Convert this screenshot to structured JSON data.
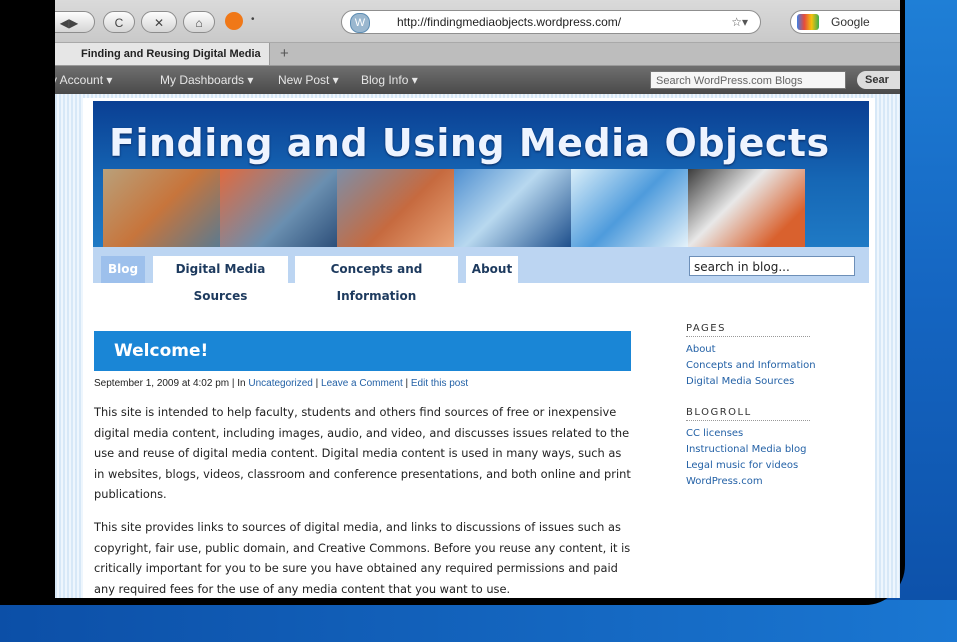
{
  "browser": {
    "url": "http://findingmediaobjects.wordpress.com/",
    "search_engine": "Google",
    "tab_title": "Finding and Reusing Digital Media",
    "new_tab": "+",
    "back_glyph": "◀▶",
    "reload_glyph": "C",
    "stop_glyph": "✕",
    "home_glyph": "⌂",
    "bookmark_glyph": "☆▾"
  },
  "wp_admin_bar": {
    "items": [
      "My Account ▾",
      "My Dashboards ▾",
      "New Post ▾",
      "Blog Info ▾"
    ],
    "search_placeholder": "Search WordPress.com Blogs",
    "search_button": "Sear"
  },
  "site": {
    "title": "Finding and Using Media Objects",
    "nav": [
      {
        "label": "Blog",
        "active": true
      },
      {
        "label": "Digital Media Sources",
        "active": false
      },
      {
        "label": "Concepts and Information",
        "active": false
      },
      {
        "label": "About",
        "active": false
      }
    ],
    "search_value": "search in blog..."
  },
  "post": {
    "title": "Welcome!",
    "meta_prefix": "September 1, 2009 at 4:02 pm | In ",
    "category": "Uncategorized",
    "sep1": " | ",
    "comment_link": "Leave a Comment",
    "sep2": " | ",
    "edit_link": "Edit this post",
    "paragraph1": "This site is intended to help faculty, students and others find  sources of free or inexpensive digital media content, including images, audio, and video, and discusses issues related to the use and reuse of digital media content. Digital media content is used in many ways, such as in websites, blogs, videos, classroom and conference presentations, and both online and print publications.",
    "paragraph2": "This site provides links to sources of digital media, and  links to discussions of issues such as copyright, fair use, public domain, and Creative Commons. Before you reuse any content, it is critically important for you to be sure you have obtained any required permissions and paid any required fees for the use of any media content that you want to use."
  },
  "sidebar": {
    "pages_heading": "PAGES",
    "pages": [
      "About",
      "Concepts and Information",
      "Digital Media Sources"
    ],
    "blogroll_heading": "BLOGROLL",
    "blogroll": [
      "CC licenses",
      "Instructional Media blog",
      "Legal music for videos",
      "WordPress.com"
    ]
  },
  "colors": {
    "slide_blue": "#1566c2",
    "header_blue": "#0a3f93",
    "post_bar": "#1a86d6",
    "link": "#2361a6"
  }
}
